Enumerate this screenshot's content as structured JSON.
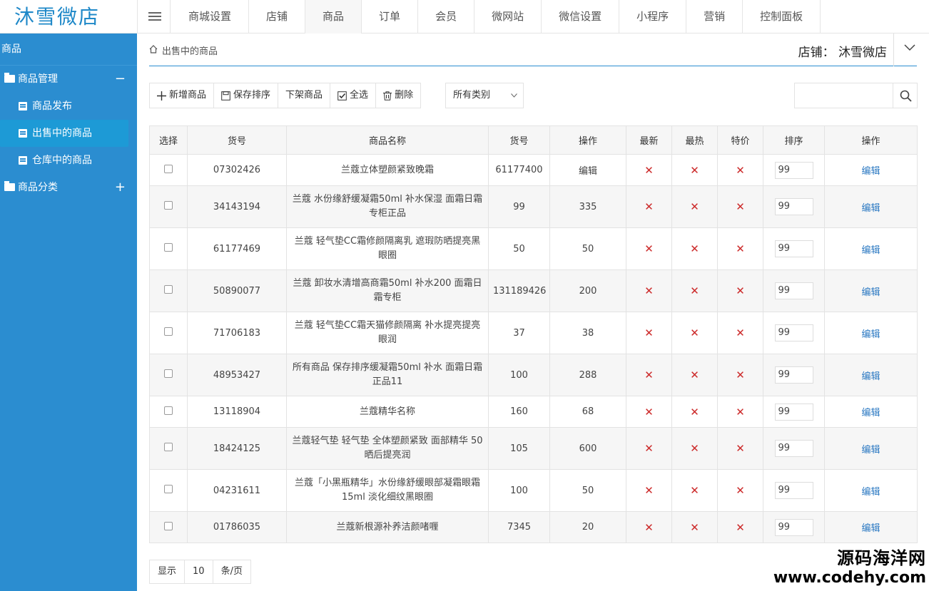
{
  "app": {
    "logo": "沐雪微店"
  },
  "nav": {
    "items": [
      "商城设置",
      "店铺",
      "商品",
      "订单",
      "会员",
      "微网站",
      "微信设置",
      "小程序",
      "营销",
      "控制面板"
    ],
    "active": 2
  },
  "sidebar": {
    "title": "商品",
    "groups": [
      {
        "label": "商品管理",
        "toggle": "−"
      },
      {
        "label": "商品分类",
        "toggle": "+"
      }
    ],
    "items": [
      "商品发布",
      "出售中的商品",
      "仓库中的商品"
    ],
    "active_item": 1
  },
  "header": {
    "breadcrumb": "出售中的商品",
    "store": "店铺： 沐雪微店"
  },
  "toolbar": {
    "add": "新增商品",
    "save_sort": "保存排序",
    "offshelf": "下架商品",
    "select_all": "全选",
    "delete": "删除",
    "category": "所有类别",
    "search_placeholder": ""
  },
  "table": {
    "headers": [
      "选择",
      "货号",
      "商品名称",
      "货号",
      "操作",
      "最新",
      "最热",
      "特价",
      "排序",
      "操作"
    ],
    "rows": [
      {
        "sku": "07302426",
        "name": "兰蔻立体塑颜紧致晚霜",
        "col4": "61177400",
        "col5": "编辑",
        "sort": "99",
        "edit": "编辑"
      },
      {
        "sku": "34143194",
        "name": "兰蔻 水份缘舒缓凝霜50ml 补水保湿 面霜日霜专柜正品",
        "col4": "99",
        "col5": "335",
        "sort": "99",
        "edit": "编辑"
      },
      {
        "sku": "61177469",
        "name": "兰蔻 轻气垫CC霜修颜隔离乳 遮瑕防晒提亮黑眼圈",
        "col4": "50",
        "col5": "50",
        "sort": "99",
        "edit": "编辑"
      },
      {
        "sku": "50890077",
        "name": "兰蔻 卸妆水清增高商霜50ml 补水200 面霜日霜专柜",
        "col4": "131189426",
        "col5": "200",
        "sort": "99",
        "edit": "编辑"
      },
      {
        "sku": "71706183",
        "name": "兰蔻 轻气垫CC霜天猫修颜隔离 补水提亮提亮眼润",
        "col4": "37",
        "col5": "38",
        "sort": "99",
        "edit": "编辑"
      },
      {
        "sku": "48953427",
        "name": "所有商品 保存排序缓凝霜50ml 补水 面霜日霜 正品11",
        "col4": "100",
        "col5": "288",
        "sort": "99",
        "edit": "编辑"
      },
      {
        "sku": "13118904",
        "name": "兰蔻精华名称",
        "col4": "160",
        "col5": "68",
        "sort": "99",
        "edit": "编辑"
      },
      {
        "sku": "18424125",
        "name": "兰蔻轻气垫 轻气垫 全体塑颜紧致 面部精华 50 晒后提亮润",
        "col4": "105",
        "col5": "600",
        "sort": "99",
        "edit": "编辑"
      },
      {
        "sku": "04231611",
        "name": "兰蔻「小黑瓶精华」水份缘舒缓眼部凝霜眼霜15ml 淡化细纹黑眼圈",
        "col4": "100",
        "col5": "50",
        "sort": "99",
        "edit": "编辑"
      },
      {
        "sku": "01786035",
        "name": "兰蔻新根源补养洁颜啫喱",
        "col4": "7345",
        "col5": "20",
        "sort": "99",
        "edit": "编辑"
      }
    ],
    "x_mark": "✕"
  },
  "pager": {
    "show": "显示",
    "size": "10",
    "per_page": "条/页"
  },
  "watermark": {
    "line1": "源码海洋网",
    "line2": "www.codehy.com"
  },
  "colors": {
    "sidebar": "#2b8dd0",
    "sidebar_active": "#1d9ad6",
    "logo": "#1e88c8",
    "x_mark": "#cc2a2a",
    "link": "#2a78c2"
  }
}
